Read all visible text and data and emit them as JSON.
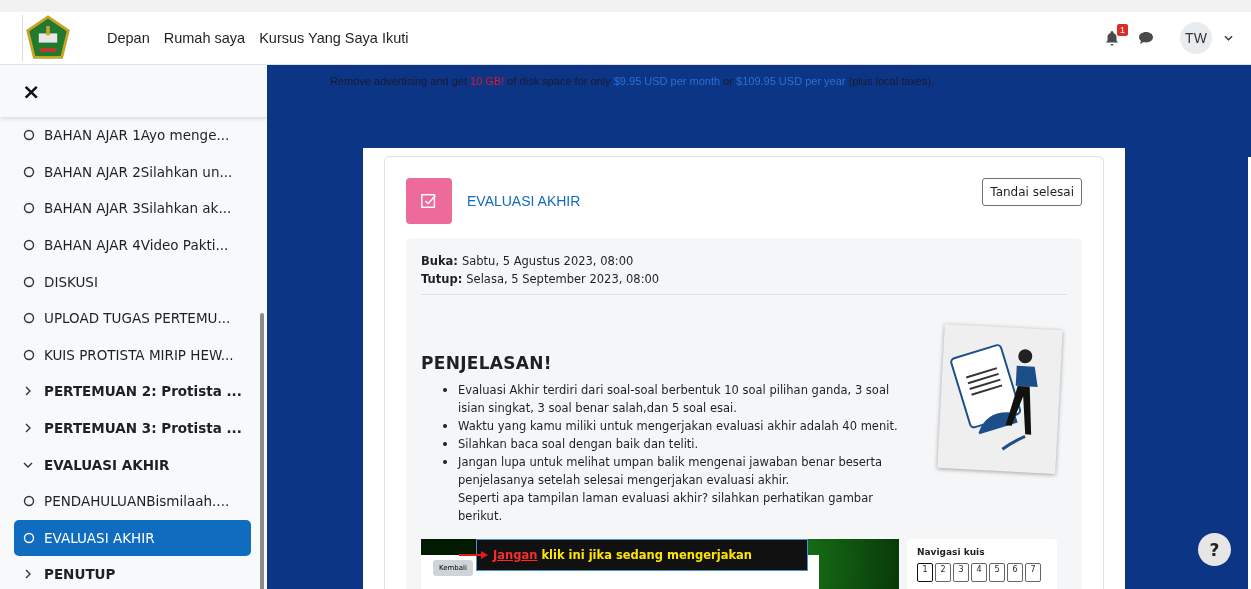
{
  "navbar": {
    "links": [
      "Depan",
      "Rumah saya",
      "Kursus Yang Saya Ikuti"
    ],
    "notification_count": "1",
    "avatar_initials": "TW"
  },
  "sidebar": {
    "close_label": "×",
    "items": [
      {
        "kind": "activity",
        "label": "BAHAN AJAR 1Ayo menge...",
        "selected": false
      },
      {
        "kind": "activity",
        "label": "BAHAN AJAR 2Silahkan un...",
        "selected": false
      },
      {
        "kind": "activity",
        "label": "BAHAN AJAR 3Silahkan ak...",
        "selected": false
      },
      {
        "kind": "activity",
        "label": "BAHAN AJAR 4Video Pakti...",
        "selected": false
      },
      {
        "kind": "activity",
        "label": "DISKUSI",
        "selected": false
      },
      {
        "kind": "activity",
        "label": "UPLOAD TUGAS PERTEMU...",
        "selected": false
      },
      {
        "kind": "activity",
        "label": "KUIS PROTISTA MIRIP HEW...",
        "selected": false
      },
      {
        "kind": "section",
        "label": "PERTEMUAN 2: Protista ...",
        "expanded": false
      },
      {
        "kind": "section",
        "label": "PERTEMUAN 3: Protista ...",
        "expanded": false
      },
      {
        "kind": "section",
        "label": "EVALUASI AKHIR",
        "expanded": true
      },
      {
        "kind": "activity",
        "label": "PENDAHULUANBismilaah....",
        "selected": false
      },
      {
        "kind": "activity",
        "label": "EVALUASI AKHIR",
        "selected": true
      },
      {
        "kind": "section",
        "label": "PENUTUP",
        "expanded": false
      }
    ]
  },
  "ad_banner": [
    {
      "kind": "plain",
      "text": "Remove advertising and get"
    },
    {
      "kind": "highlight",
      "text": "10 GB!"
    },
    {
      "kind": "plain",
      "text": "of disk space for only"
    },
    {
      "kind": "link",
      "text": "$9.95 USD per month"
    },
    {
      "kind": "plain",
      "text": "or"
    },
    {
      "kind": "link",
      "text": "$109.95 USD per year"
    },
    {
      "kind": "plain",
      "text": "(plus local taxes)."
    }
  ],
  "activity": {
    "title": "EVALUASI AKHIR",
    "mark_done_button": "Tandai selesai",
    "dates": [
      {
        "label": "Buka:",
        "value": "Sabtu, 5 Agustus 2023, 08:00"
      },
      {
        "label": "Tutup:",
        "value": "Selasa, 5 September 2023, 08:00"
      }
    ],
    "heading": "PENJELASAN!",
    "bullets": [
      "Evaluasi Akhir terdiri dari soal-soal  berbentuk 10 soal  pilihan ganda, 3 soal isian singkat, 3 soal benar salah,dan 5 soal esai.",
      "Waktu yang kamu miliki untuk mengerjakan evaluasi akhir adalah 40 menit.",
      "Silahkan baca soal dengan baik dan teliti.",
      "Jangan lupa untuk melihat umpan balik mengenai jawaban benar beserta penjelasanya setelah selesai mengerjakan evaluasi akhir."
    ],
    "note": "Seperti apa tampilan laman evaluasi akhir? silahkan perhatikan gambar berikut.",
    "screenshot": {
      "back_button": "Kembali",
      "warning_word": "Jangan",
      "warning_rest": "klik ini jika sedang mengerjakan",
      "nav_title": "Navigasi kuis",
      "questions": [
        {
          "label": "1",
          "selected": true
        },
        {
          "label": "2",
          "selected": false
        },
        {
          "label": "3",
          "selected": false
        },
        {
          "label": "4",
          "selected": false
        },
        {
          "label": "5",
          "selected": false
        },
        {
          "label": "6",
          "selected": false
        },
        {
          "label": "7",
          "selected": false
        }
      ]
    }
  },
  "help_button": "?"
}
